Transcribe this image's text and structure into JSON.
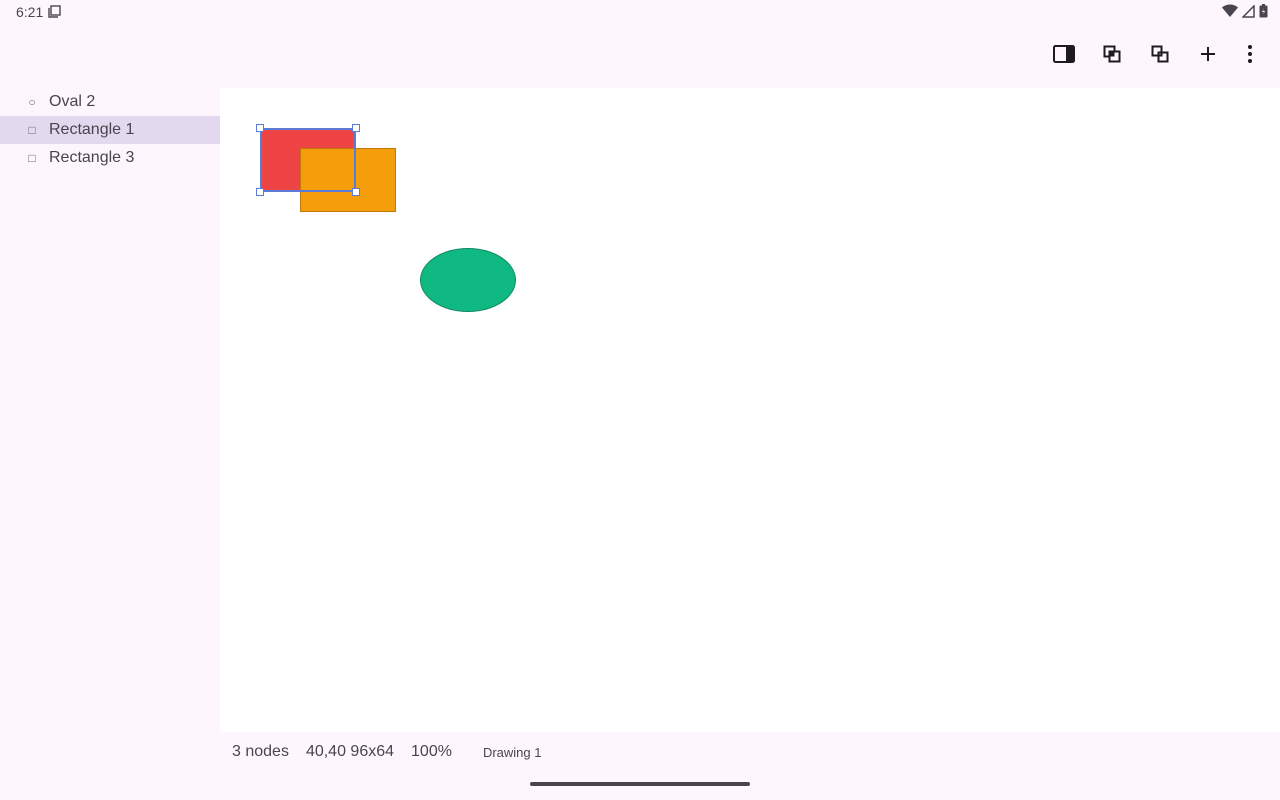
{
  "status_bar": {
    "time": "6:21",
    "icons": [
      "notification-icon",
      "wifi-icon",
      "signal-icon",
      "battery-icon"
    ]
  },
  "toolbar": {
    "buttons": [
      {
        "name": "toggle-panel",
        "icon": "side-panel-icon"
      },
      {
        "name": "bring-forward",
        "icon": "bring-forward-icon"
      },
      {
        "name": "send-backward",
        "icon": "send-backward-icon"
      },
      {
        "name": "add",
        "icon": "plus-icon"
      },
      {
        "name": "more",
        "icon": "more-vert-icon"
      }
    ]
  },
  "layers": [
    {
      "glyph": "○",
      "label": "Oval 2",
      "selected": false
    },
    {
      "glyph": "□",
      "label": "Rectangle 1",
      "selected": true
    },
    {
      "glyph": "□",
      "label": "Rectangle 3",
      "selected": false
    }
  ],
  "shapes": [
    {
      "name": "rectangle-1",
      "kind": "rectangle",
      "fill": "#ef4444",
      "stroke": "#b91c1c",
      "selected": true
    },
    {
      "name": "rectangle-3",
      "kind": "rectangle",
      "fill": "#f59e0b",
      "stroke": "#c2760a",
      "selected": false
    },
    {
      "name": "oval-2",
      "kind": "oval",
      "fill": "#10b981",
      "stroke": "#0f8a62",
      "selected": false
    }
  ],
  "colors": {
    "selection": "#5c7bd9",
    "selected_layer_bg": "#e3d9ef",
    "background": "#fdf7fd"
  },
  "footer": {
    "node_count": "3 nodes",
    "selection_info": "40,40 96x64",
    "zoom": "100%",
    "document_name": "Drawing 1"
  }
}
